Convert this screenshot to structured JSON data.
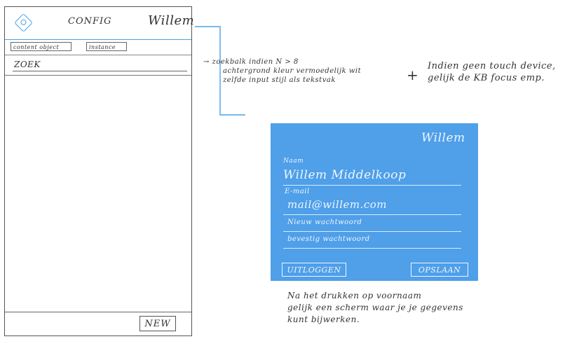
{
  "phone": {
    "title": "CONFIG",
    "user": "Willem",
    "tabs": [
      "content object",
      "instance"
    ],
    "search_placeholder": "ZOEK",
    "new_label": "NEW"
  },
  "notes": {
    "search_note": [
      "→ zoekbalk indien N > 8",
      "achtergrond kleur vermoedelijk wit",
      "zelfde input stijl als tekstvak"
    ],
    "plus": "+",
    "touch_note": [
      "Indien geen touch device,",
      "gelijk de KB focus emp."
    ],
    "bottom_note": [
      "Na het drukken op voornaam",
      "gelijk een scherm waar je je gegevens",
      "kunt bijwerken."
    ]
  },
  "panel": {
    "user": "Willem",
    "name_label": "Naam",
    "name_value": "Willem Middelkoop",
    "email_label": "E-mail",
    "email_value": "mail@willem.com",
    "new_password": "Nieuw wachtwoord",
    "confirm_password": "bevestig wachtwoord",
    "logout": "UITLOGGEN",
    "save": "OPSLAAN"
  },
  "colors": {
    "accent": "#4aa3e6",
    "panel": "#4f9fe9"
  }
}
